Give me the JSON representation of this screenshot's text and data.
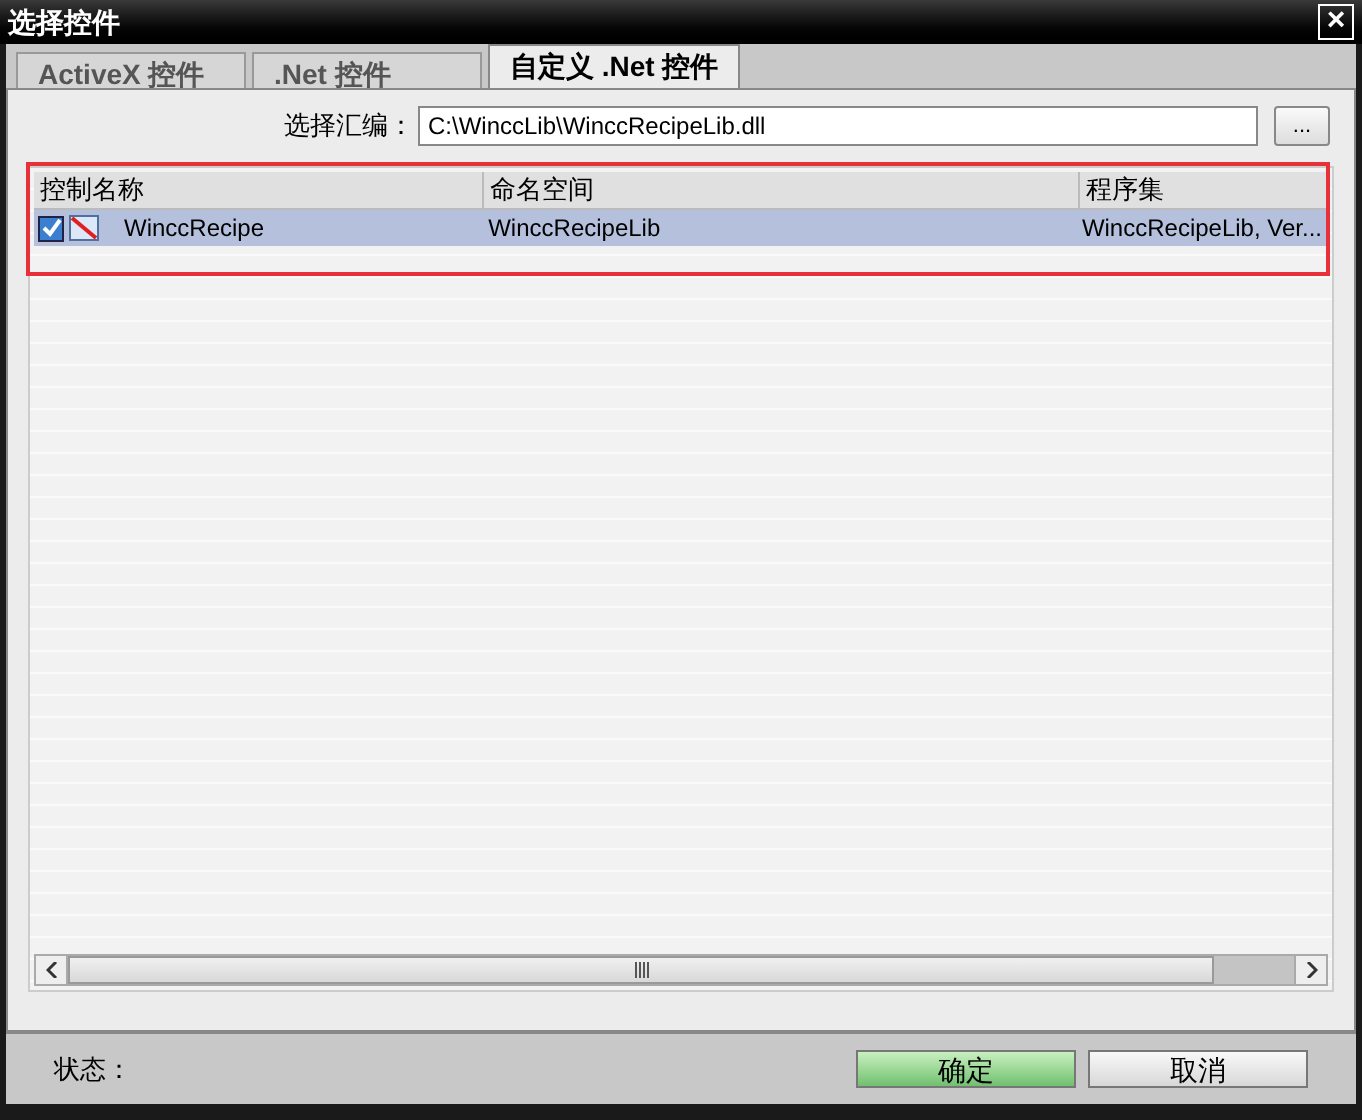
{
  "window": {
    "title": "选择控件",
    "close": "×"
  },
  "tabs": [
    {
      "label": "ActiveX 控件",
      "selected": false
    },
    {
      "label": ".Net 控件",
      "selected": false
    },
    {
      "label": "自定义 .Net 控件",
      "selected": true
    }
  ],
  "assembly": {
    "label": "选择汇编：",
    "value": "C:\\WinccLib\\WinccRecipeLib.dll",
    "browse": "..."
  },
  "table": {
    "columns": [
      "控制名称",
      "命名空间",
      "程序集"
    ],
    "rows": [
      {
        "checked": true,
        "selected": true,
        "name": "WinccRecipe",
        "namespace": "WinccRecipeLib",
        "assembly": "WinccRecipeLib, Ver..."
      }
    ]
  },
  "status_bar": {
    "label": "状态："
  },
  "buttons": [
    {
      "label": "确定",
      "kind": "primary"
    },
    {
      "label": "取消",
      "kind": "normal"
    }
  ]
}
